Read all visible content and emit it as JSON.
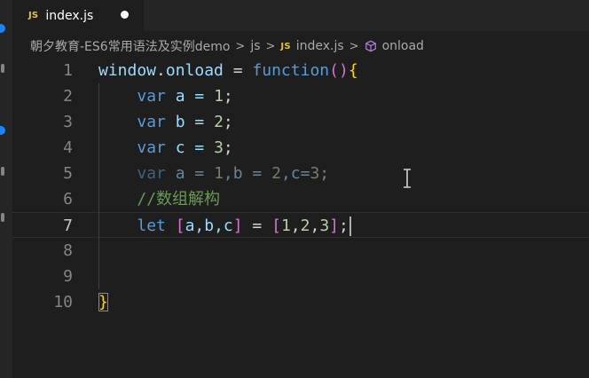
{
  "tab": {
    "icon": "js-file-icon",
    "badge": "JS",
    "title": "index.js",
    "modified": true
  },
  "breadcrumb": {
    "project": "朝夕教育-ES6常用语法及实例demo",
    "folder": "js",
    "file_badge": "JS",
    "file": "index.js",
    "symbol": "onload",
    "separator": ">"
  },
  "editor": {
    "current_line": 7,
    "line_numbers": [
      "1",
      "2",
      "3",
      "4",
      "5",
      "6",
      "7",
      "8",
      "9",
      "10"
    ],
    "lines": [
      {
        "n": 1,
        "tokens": [
          {
            "t": "window",
            "c": "obj"
          },
          {
            "t": ".",
            "c": "plain"
          },
          {
            "t": "onload",
            "c": "obj"
          },
          {
            "t": " = ",
            "c": "plain"
          },
          {
            "t": "function",
            "c": "kw"
          },
          {
            "t": "()",
            "c": "paren"
          },
          {
            "t": "{",
            "c": "brace"
          }
        ]
      },
      {
        "n": 2,
        "tokens": [
          {
            "t": "    ",
            "c": "plain"
          },
          {
            "t": "var",
            "c": "kw"
          },
          {
            "t": " a = ",
            "c": "obj"
          },
          {
            "t": "1",
            "c": "num"
          },
          {
            "t": ";",
            "c": "plain"
          }
        ]
      },
      {
        "n": 3,
        "tokens": [
          {
            "t": "    ",
            "c": "plain"
          },
          {
            "t": "var",
            "c": "kw"
          },
          {
            "t": " b = ",
            "c": "obj"
          },
          {
            "t": "2",
            "c": "num"
          },
          {
            "t": ";",
            "c": "plain"
          }
        ]
      },
      {
        "n": 4,
        "tokens": [
          {
            "t": "    ",
            "c": "plain"
          },
          {
            "t": "var",
            "c": "kw"
          },
          {
            "t": " c = ",
            "c": "obj"
          },
          {
            "t": "3",
            "c": "num"
          },
          {
            "t": ";",
            "c": "plain"
          }
        ]
      },
      {
        "n": 5,
        "tokens": [
          {
            "t": "    ",
            "c": "plain"
          },
          {
            "t": "var",
            "c": "kw dim"
          },
          {
            "t": " a = ",
            "c": "obj dim"
          },
          {
            "t": "1",
            "c": "num dim"
          },
          {
            "t": ",b = ",
            "c": "obj dim"
          },
          {
            "t": "2",
            "c": "num dim"
          },
          {
            "t": ",c=",
            "c": "obj dim"
          },
          {
            "t": "3",
            "c": "num dim"
          },
          {
            "t": ";",
            "c": "plain dim"
          }
        ]
      },
      {
        "n": 6,
        "tokens": [
          {
            "t": "    ",
            "c": "plain"
          },
          {
            "t": "//数组解构",
            "c": "cmt"
          }
        ]
      },
      {
        "n": 7,
        "tokens": [
          {
            "t": "    ",
            "c": "plain"
          },
          {
            "t": "let",
            "c": "kw"
          },
          {
            "t": " ",
            "c": "plain"
          },
          {
            "t": "[",
            "c": "brk"
          },
          {
            "t": "a,b,c",
            "c": "obj"
          },
          {
            "t": "]",
            "c": "brk"
          },
          {
            "t": " = ",
            "c": "plain"
          },
          {
            "t": "[",
            "c": "brk"
          },
          {
            "t": "1",
            "c": "num"
          },
          {
            "t": ",",
            "c": "plain"
          },
          {
            "t": "2",
            "c": "num"
          },
          {
            "t": ",",
            "c": "plain"
          },
          {
            "t": "3",
            "c": "num"
          },
          {
            "t": "]",
            "c": "brk"
          },
          {
            "t": ";",
            "c": "plain"
          }
        ],
        "caret": true
      },
      {
        "n": 8,
        "tokens": []
      },
      {
        "n": 9,
        "tokens": []
      },
      {
        "n": 10,
        "tokens": [
          {
            "t": "}",
            "c": "brace boxed"
          }
        ]
      }
    ]
  },
  "colors": {
    "background": "#1e1e1e",
    "keyword": "#569cd6",
    "variable": "#9cdcfe",
    "number": "#b5cea8",
    "comment": "#6a9955",
    "brace": "#ffd700",
    "bracket": "#da70d6",
    "js_badge": "#e8c238"
  },
  "icons": [
    "js-file-icon",
    "symbol-cube-icon",
    "text-cursor-icon",
    "modified-dot-icon"
  ]
}
